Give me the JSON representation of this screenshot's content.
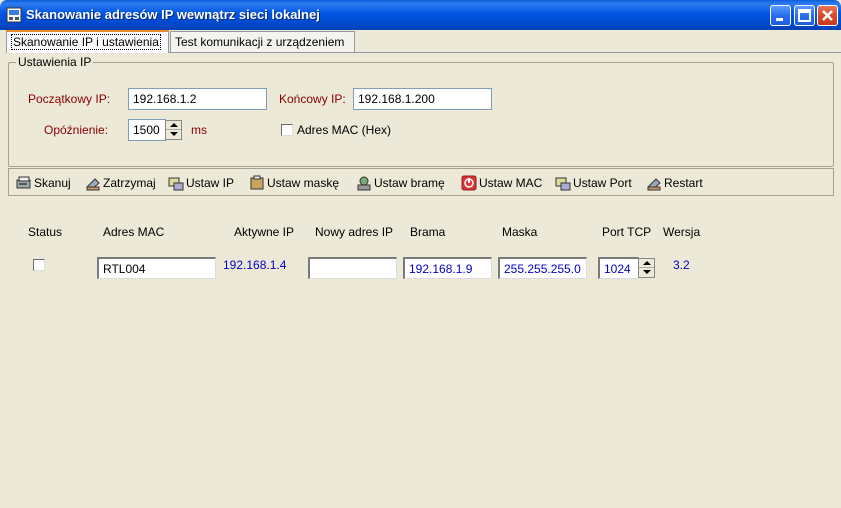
{
  "window": {
    "title": "Skanowanie adresów IP wewnątrz sieci lokalnej",
    "controls": [
      "minimize",
      "maximize",
      "close"
    ]
  },
  "tabs": [
    {
      "label": "Skanowanie IP i ustawienia",
      "active": true
    },
    {
      "label": "Test komunikacji z urządzeniem",
      "active": false
    }
  ],
  "settings": {
    "group_label": "Ustawienia IP",
    "start_ip_label": "Początkowy IP:",
    "start_ip_value": "192.168.1.2",
    "end_ip_label": "Końcowy IP:",
    "end_ip_value": "192.168.1.200",
    "delay_label": "Opóźnienie:",
    "delay_value": "1500",
    "delay_unit": "ms",
    "mac_hex_label": "Adres MAC (Hex)",
    "mac_hex_checked": false
  },
  "toolbar": {
    "scan": "Skanuj",
    "stop": "Zatrzymaj",
    "set_ip": "Ustaw IP",
    "set_mask": "Ustaw maskę",
    "set_gateway": "Ustaw bramę",
    "set_mac": "Ustaw MAC",
    "set_port": "Ustaw Port",
    "restart": "Restart"
  },
  "table": {
    "headers": {
      "status": "Status",
      "mac": "Adres MAC",
      "active_ip": "Aktywne IP",
      "new_ip": "Nowy adres IP",
      "gateway": "Brama",
      "mask": "Maska",
      "port": "Port TCP",
      "version": "Wersja"
    },
    "rows": [
      {
        "status_checked": false,
        "mac": "RTL004",
        "active_ip": "192.168.1.4",
        "new_ip": "",
        "gateway": "192.168.1.9",
        "mask": "255.255.255.0",
        "port": "1024",
        "version": "3.2"
      }
    ]
  },
  "colors": {
    "label_red": "#8b0000",
    "value_blue": "#0000c8",
    "titlebar_blue": "#0054e3",
    "window_bg": "#ece9d8"
  },
  "icons": {
    "scan": "scan-icon",
    "stop": "stop-icon",
    "set_ip": "set-ip-icon",
    "set_mask": "set-mask-icon",
    "set_gateway": "set-gateway-icon",
    "set_mac": "set-mac-icon",
    "set_port": "set-port-icon",
    "restart": "restart-icon"
  }
}
